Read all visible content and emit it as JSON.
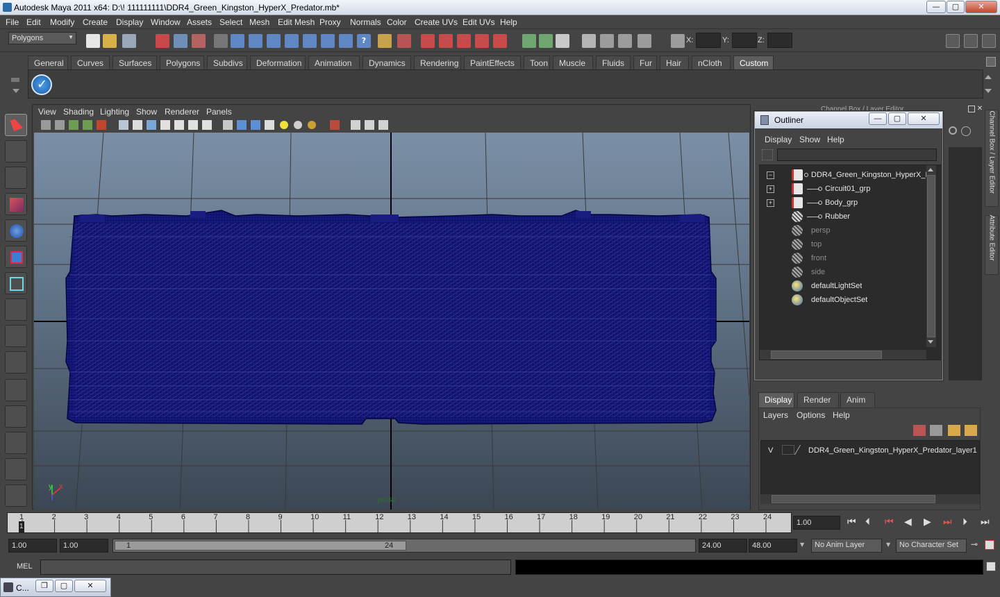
{
  "window": {
    "title": "Autodesk Maya 2011 x64: D:\\! 111111111\\DDR4_Green_Kingston_HyperX_Predator.mb*",
    "controls": [
      "—",
      "▢",
      "✕"
    ]
  },
  "menubar": [
    "File",
    "Edit",
    "Modify",
    "Create",
    "Display",
    "Window",
    "Assets",
    "Select",
    "Mesh",
    "Edit Mesh",
    "Proxy",
    "Normals",
    "Color",
    "Create UVs",
    "Edit UVs",
    "Help"
  ],
  "status_line": {
    "mode": "Polygons",
    "x_label": "X:",
    "y_label": "Y:",
    "z_label": "Z:"
  },
  "shelf": {
    "tabs": [
      "General",
      "Curves",
      "Surfaces",
      "Polygons",
      "Subdivs",
      "Deformation",
      "Animation",
      "Dynamics",
      "Rendering",
      "PaintEffects",
      "Toon",
      "Muscle",
      "Fluids",
      "Fur",
      "Hair",
      "nCloth",
      "Custom"
    ],
    "active": "Custom"
  },
  "viewport": {
    "menu": [
      "View",
      "Shading",
      "Lighting",
      "Show",
      "Renderer",
      "Panels"
    ],
    "camera_label": "persp",
    "axis_y": "y",
    "axis_x": "x"
  },
  "outliner": {
    "title": "Outliner",
    "menu": [
      "Display",
      "Show",
      "Help"
    ],
    "items": [
      {
        "label": "DDR4_Green_Kingston_HyperX_Pr",
        "expander": "−",
        "icon": "transform-icon",
        "dim": false,
        "indent": 0
      },
      {
        "label": "Circuit01_grp",
        "expander": "+",
        "icon": "transform-icon",
        "dim": false,
        "indent": 1
      },
      {
        "label": "Body_grp",
        "expander": "+",
        "icon": "transform-icon",
        "dim": false,
        "indent": 1
      },
      {
        "label": "Rubber",
        "expander": "",
        "icon": "mesh-icon",
        "dim": false,
        "indent": 1
      },
      {
        "label": "persp",
        "expander": "",
        "icon": "camera-icon",
        "dim": true,
        "indent": 0
      },
      {
        "label": "top",
        "expander": "",
        "icon": "camera-icon",
        "dim": true,
        "indent": 0
      },
      {
        "label": "front",
        "expander": "",
        "icon": "camera-icon",
        "dim": true,
        "indent": 0
      },
      {
        "label": "side",
        "expander": "",
        "icon": "camera-icon",
        "dim": true,
        "indent": 0
      },
      {
        "label": "defaultLightSet",
        "expander": "",
        "icon": "set-icon",
        "dim": false,
        "indent": 0
      },
      {
        "label": "defaultObjectSet",
        "expander": "",
        "icon": "set-icon",
        "dim": false,
        "indent": 0
      }
    ]
  },
  "channel_box_title": "Channel Box / Layer Editor",
  "side_tabs": [
    "Channel Box / Layer Editor",
    "Attribute Editor"
  ],
  "layer_editor": {
    "tabs": [
      "Display",
      "Render",
      "Anim"
    ],
    "active": "Display",
    "menu": [
      "Layers",
      "Options",
      "Help"
    ],
    "layer": {
      "visible": "V",
      "name": "DDR4_Green_Kingston_HyperX_Predator_layer1"
    }
  },
  "timeline": {
    "ticks": [
      "1",
      "2",
      "3",
      "4",
      "5",
      "6",
      "7",
      "8",
      "9",
      "10",
      "11",
      "12",
      "13",
      "14",
      "15",
      "16",
      "17",
      "18",
      "19",
      "20",
      "21",
      "22",
      "23",
      "24"
    ],
    "current_frame_marker": "1",
    "current_time": "1.00"
  },
  "range": {
    "start": "1.00",
    "playback_start": "1.00",
    "slider_start": "1",
    "slider_end": "24",
    "playback_end": "24.00",
    "end": "48.00",
    "anim_layer": "No Anim Layer",
    "character_set": "No Character Set"
  },
  "command_line": {
    "label": "MEL"
  },
  "taskbar": {
    "label": "C..."
  },
  "colors": {
    "wireframe": "#0f1170",
    "panel_bg": "#444444",
    "field_bg": "#2b2b2b",
    "viewport_top": "#7b8fa6"
  }
}
